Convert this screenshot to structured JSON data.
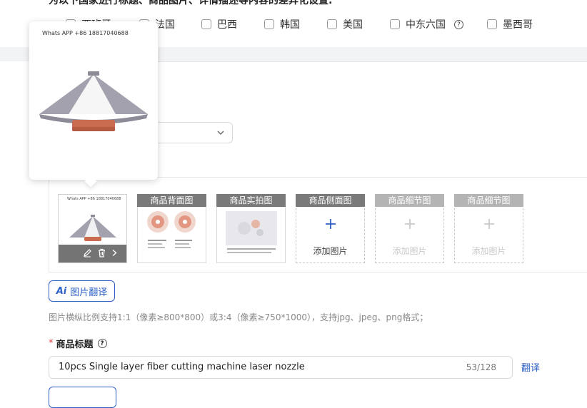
{
  "countries": {
    "title": "为以下国家进行标题、商品图片、详情描述等内容的差异化设置:",
    "items": [
      {
        "label": "西班牙"
      },
      {
        "label": "法国"
      },
      {
        "label": "巴西"
      },
      {
        "label": "韩国"
      },
      {
        "label": "美国"
      },
      {
        "label": "中东六国"
      },
      {
        "label": "墨西哥"
      }
    ]
  },
  "images": {
    "slots": [
      {
        "header": "",
        "watermark": "Whats APP +86 18817040688"
      },
      {
        "header": "商品背面图"
      },
      {
        "header": "商品实拍图"
      },
      {
        "header": "商品侧面图",
        "add_label": "添加图片"
      },
      {
        "header": "商品细节图",
        "add_label": "添加图片"
      },
      {
        "header": "商品细节图",
        "add_label": "添加图片"
      }
    ],
    "translate_button": "图片翻译",
    "translate_ai_mark": "Ai",
    "hint": "图片横纵比例支持1:1（像素≥800*800）或3:4（像素≥750*1000），支持jpg、jpeg、png格式；"
  },
  "product_title": {
    "label": "商品标题",
    "required_mark": "*",
    "value": "10pcs Single layer fiber cutting machine laser nozzle",
    "count": "53/128",
    "translate_link": "翻译"
  },
  "preview": {
    "watermark": "Whats APP +86 18817040688"
  },
  "icons": {
    "help": "question-circle-icon",
    "edit": "pencil-icon",
    "delete": "trash-icon",
    "next": "chevron-right-icon",
    "add": "plus-icon",
    "dropdown": "chevron-down-icon"
  },
  "colors": {
    "accent": "#2d5fc6",
    "required": "#e23c3c",
    "slot_header": "#7a7a7a",
    "slot_header_faded": "#b4b4b4",
    "nozzle_body": "#a3a1ad",
    "nozzle_copper": "#c86b4f"
  }
}
